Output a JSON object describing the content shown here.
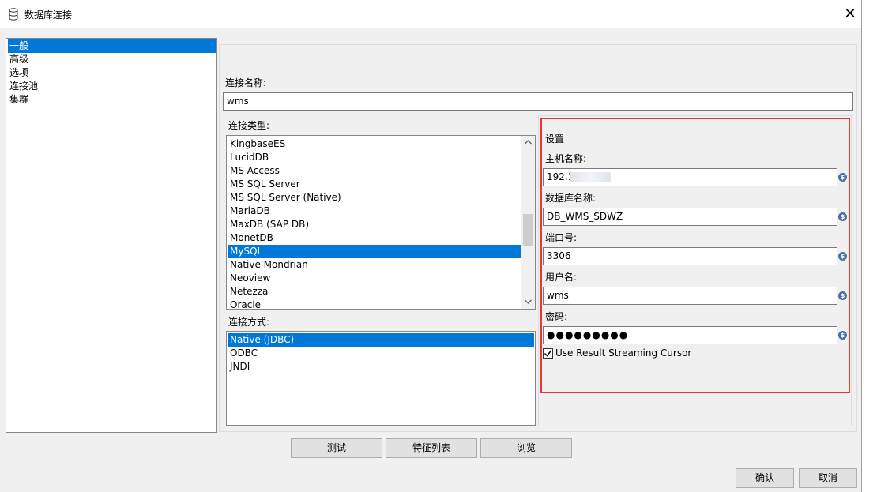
{
  "window": {
    "title": "数据库连接",
    "close_glyph": "✕"
  },
  "nav": {
    "items": [
      "一般",
      "高级",
      "选项",
      "连接池",
      "集群"
    ],
    "selected": 0
  },
  "general": {
    "conn_name_label": "连接名称:",
    "conn_name_value": "wms",
    "conn_type_label": "连接类型:",
    "conn_types": [
      "KingbaseES",
      "LucidDB",
      "MS Access",
      "MS SQL Server",
      "MS SQL Server (Native)",
      "MariaDB",
      "MaxDB (SAP DB)",
      "MonetDB",
      "MySQL",
      "Native Mondrian",
      "Neoview",
      "Netezza",
      "Oracle"
    ],
    "conn_type_selected": 8,
    "access_label": "连接方式:",
    "access_methods": [
      "Native (JDBC)",
      "ODBC",
      "JNDI"
    ],
    "access_selected": 0
  },
  "settings": {
    "title": "设置",
    "host_label": "主机名称:",
    "host_value": "192.1",
    "db_label": "数据库名称:",
    "db_value": "DB_WMS_SDWZ",
    "port_label": "端口号:",
    "port_value": "3306",
    "user_label": "用户名:",
    "user_value": "wms",
    "pwd_label": "密码:",
    "pwd_value": "●●●●●●●●●",
    "streaming_label": "Use Result Streaming Cursor",
    "streaming_checked": true,
    "var_glyph": "$"
  },
  "buttons": {
    "test": "测试",
    "features": "特征列表",
    "browse": "浏览",
    "ok": "确认",
    "cancel": "取消"
  },
  "colors": {
    "selection": "#0078d7",
    "highlight_frame": "#e53935",
    "var_icon": "#4a6fa5"
  }
}
